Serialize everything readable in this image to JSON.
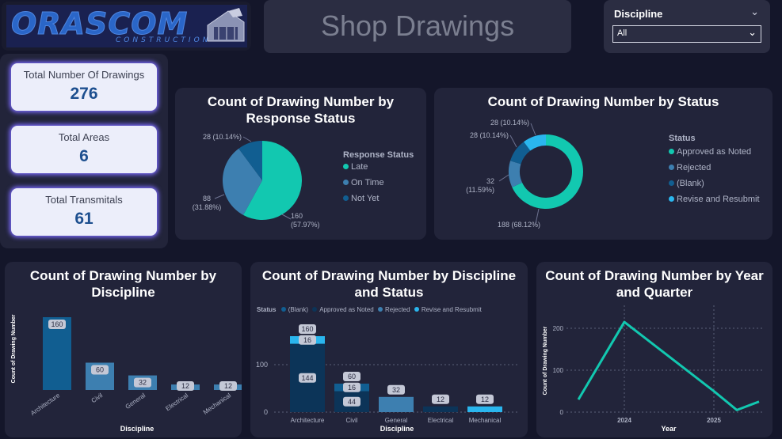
{
  "logo": {
    "wordmark": "ORASCOM",
    "tagline": "CONSTRUCTION"
  },
  "header": {
    "title": "Shop Drawings"
  },
  "slicer": {
    "label": "Discipline",
    "value": "All"
  },
  "kpis": [
    {
      "label": "Total Number Of Drawings",
      "value": "276"
    },
    {
      "label": "Total Areas",
      "value": "6"
    },
    {
      "label": "Total Transmitals",
      "value": "61"
    }
  ],
  "colors": {
    "late": "#12c8b0",
    "on_time": "#3d7fb0",
    "not_yet": "#115e91",
    "approved": "#12c8b0",
    "rejected": "#3d7fb0",
    "blank": "#115e91",
    "revise": "#2ab6ee",
    "bar_blank": "#115e91",
    "bar_approved": "#0c3458",
    "bar_rejected": "#3d7fb0",
    "bar_revise": "#2ab6ee",
    "line": "#12c8b0"
  },
  "chart_data": [
    {
      "type": "pie",
      "title": "Count of Drawing Number by Response Status",
      "legend_title": "Response Status",
      "legend_position": "right",
      "slices": [
        {
          "name": "Late",
          "value": 160,
          "label": "160 (57.97%)"
        },
        {
          "name": "On Time",
          "value": 88,
          "label": "88 (31.88%)"
        },
        {
          "name": "Not Yet",
          "value": 28,
          "label": "28 (10.14%)"
        }
      ]
    },
    {
      "type": "pie",
      "title": "Count of Drawing Number by Status",
      "legend_title": "Status",
      "legend_position": "right",
      "donut": true,
      "slices": [
        {
          "name": "Approved as Noted",
          "value": 188,
          "label": "188 (68.12%)"
        },
        {
          "name": "Rejected",
          "value": 32,
          "label": "32 (11.59%)"
        },
        {
          "name": "(Blank)",
          "value": 28,
          "label": "28 (10.14%)"
        },
        {
          "name": "Revise and Resubmit",
          "value": 28,
          "label": "28 (10.14%)"
        }
      ]
    },
    {
      "type": "bar",
      "title": "Count of Drawing Number by Discipline",
      "xlabel": "Discipline",
      "ylabel": "Count of Drawing Number",
      "categories": [
        "Architecture",
        "Civil",
        "General",
        "Electrical",
        "Mechanical"
      ],
      "values": [
        160,
        60,
        32,
        12,
        12
      ]
    },
    {
      "type": "bar",
      "stacked": true,
      "title": "Count of Drawing Number by Discipline and Status",
      "xlabel": "Discipline",
      "legend_title": "Status",
      "legend_position": "top",
      "grid": true,
      "categories": [
        "Architecture",
        "Civil",
        "General",
        "Electrical",
        "Mechanical"
      ],
      "yticks": [
        0,
        100
      ],
      "ylim": [
        0,
        170
      ],
      "series": [
        {
          "name": "(Blank)",
          "values": [
            0,
            16,
            0,
            0,
            0
          ]
        },
        {
          "name": "Approved as Noted",
          "values": [
            144,
            44,
            0,
            12,
            0
          ]
        },
        {
          "name": "Rejected",
          "values": [
            0,
            0,
            32,
            0,
            0
          ]
        },
        {
          "name": "Revise and Resubmit",
          "values": [
            16,
            0,
            0,
            0,
            12
          ]
        }
      ],
      "totals": [
        160,
        60,
        32,
        12,
        12
      ]
    },
    {
      "type": "line",
      "title": "Count of Drawing Number by Year and Quarter",
      "xlabel": "Year",
      "ylabel": "Count of Drawing Number",
      "grid": true,
      "xticks": [
        "2024",
        "2025"
      ],
      "yticks": [
        0,
        100,
        200
      ],
      "ylim": [
        0,
        230
      ],
      "points": [
        {
          "x": "2023 Q4",
          "y": 30
        },
        {
          "x": "2024 Q1",
          "y": 215
        },
        {
          "x": "2025 Q1",
          "y": 50
        },
        {
          "x": "2025 Q2",
          "y": 5
        },
        {
          "x": "2025 Q3",
          "y": 25
        }
      ]
    }
  ]
}
